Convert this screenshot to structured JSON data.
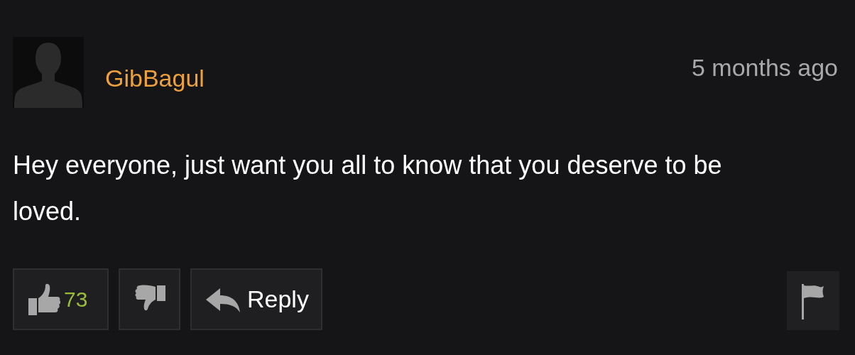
{
  "comment": {
    "author": "GibBagul",
    "time": "5 months ago",
    "text": "Hey everyone, just want you all to know that you deserve to be loved."
  },
  "actions": {
    "likes": "73",
    "reply": "Reply"
  }
}
